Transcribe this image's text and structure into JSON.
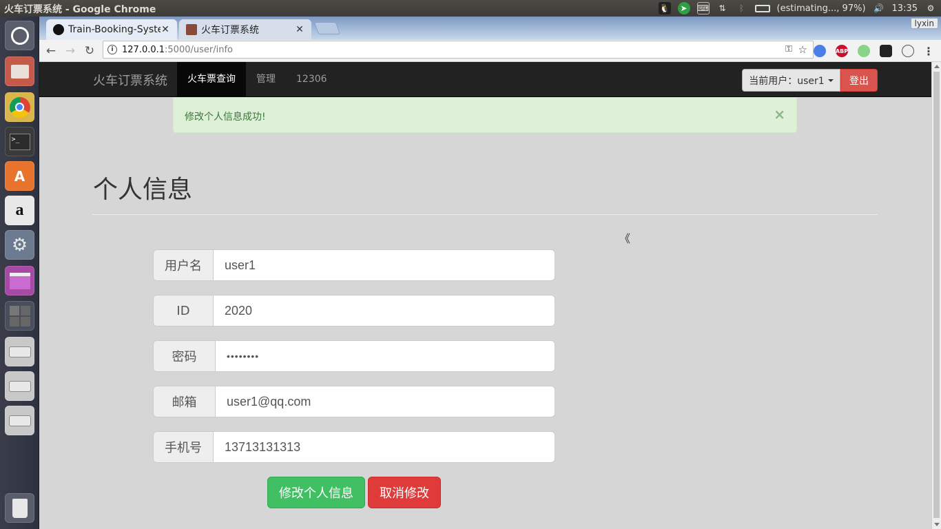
{
  "system": {
    "window_title": "火车订票系统 - Google Chrome",
    "battery": "(estimating..., 97%)",
    "clock": "13:35",
    "profile_name": "lyxin"
  },
  "browser": {
    "tabs": [
      {
        "label": "Train-Booking-Syste",
        "active": true
      },
      {
        "label": "火车订票系统",
        "active": false
      }
    ],
    "url_host": "127.0.0.1",
    "url_path": ":5000/user/info",
    "extensions": [
      "shield-icon",
      "abp-icon",
      "green-dot-icon",
      "mask-icon",
      "cat-icon",
      "menu-icon"
    ],
    "ext_abp_label": "ABP"
  },
  "navbar": {
    "brand": "火车订票系统",
    "links": [
      "火车票查询",
      "管理",
      "12306"
    ],
    "active_index": 0,
    "user_button": "当前用户：user1",
    "logout_button": "登出"
  },
  "alert": {
    "message": "修改个人信息成功!",
    "close_symbol": "×"
  },
  "page": {
    "title": "个人信息",
    "collapse_symbol": "《"
  },
  "form": {
    "fields": [
      {
        "label": "用户名",
        "value": "user1"
      },
      {
        "label": "ID",
        "value": "2020"
      },
      {
        "label": "密码",
        "value": "••••••••"
      },
      {
        "label": "邮箱",
        "value": "user1@qq.com"
      },
      {
        "label": "手机号",
        "value": "13713131313"
      }
    ],
    "submit_button": "修改个人信息",
    "cancel_button": "取消修改"
  },
  "colors": {
    "navbar_bg": "#222222",
    "alert_bg": "#dff0d8",
    "success": "#40c062",
    "danger": "#e03b3b"
  }
}
